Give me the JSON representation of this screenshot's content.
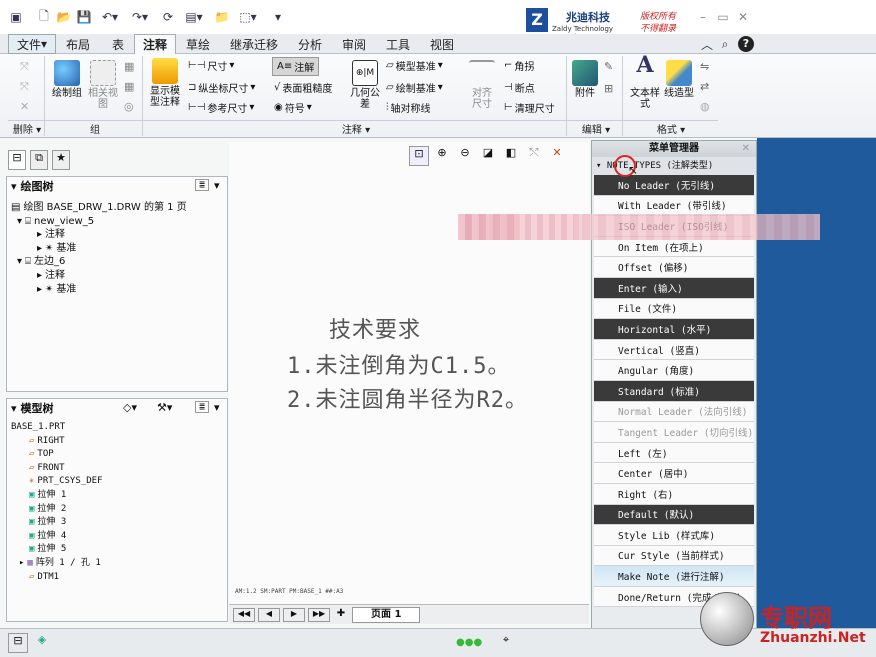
{
  "tabs": [
    "文件",
    "布局",
    "表",
    "注释",
    "草绘",
    "继承迁移",
    "分析",
    "审阅",
    "工具",
    "视图"
  ],
  "logo": {
    "company": "兆迪科技",
    "sub": "Zaldy Technology Co.,Ltd.",
    "note1": "版权所有",
    "note2": "不得翻录"
  },
  "ribbon": {
    "draw_group": "绘制组",
    "related_view": "相关视图",
    "show_model": "显示模型注释",
    "dim": "尺寸",
    "ordinate": "纵坐标尺寸",
    "ref_dim": "参考尺寸",
    "note": "注解",
    "surface": "表面粗糙度",
    "symbol": "符号",
    "geo_tol": "几何公差",
    "model_datum": "模型基准",
    "draw_datum": "绘制基准",
    "axis_sym": "轴对称线",
    "align": "对齐尺寸",
    "corner": "角拐",
    "breakpt": "断点",
    "clean": "清理尺寸",
    "attach": "附件",
    "text_style": "文本样式",
    "line_style": "线造型",
    "g_delete": "删除",
    "g_group": "组",
    "g_annot": "注释",
    "g_edit": "编辑",
    "g_format": "格式"
  },
  "draw_tree": {
    "title": "绘图树",
    "items": [
      "绘图 BASE_DRW_1.DRW 的第 1 页",
      "new_view_5",
      "注释",
      "基准",
      "左边_6",
      "注释",
      "基准"
    ]
  },
  "model_tree": {
    "title": "模型树",
    "items": [
      "BASE_1.PRT",
      "RIGHT",
      "TOP",
      "FRONT",
      "PRT_CSYS_DEF",
      "拉伸 1",
      "拉伸 2",
      "拉伸 3",
      "拉伸 4",
      "拉伸 5",
      "阵列 1 / 孔 1",
      "DTM1"
    ]
  },
  "canvas_note": {
    "l1": "技术要求",
    "l2": "1.未注倒角为C1.5。",
    "l3": "2.未注圆角半径为R2。"
  },
  "canvas_status": "AM:1.2     SM:PART  PM:BASE_1  ##:A3",
  "page_label": "页面 1",
  "menu": {
    "title": "菜单管理器",
    "header": "NOTE TYPES (注解类型)",
    "items": [
      {
        "t": "No Leader (无引线)",
        "s": "hl"
      },
      {
        "t": "With Leader (带引线)",
        "s": ""
      },
      {
        "t": "ISO Leader (ISO引线)",
        "s": ""
      },
      {
        "t": "On Item (在项上)",
        "s": ""
      },
      {
        "t": "Offset (偏移)",
        "s": ""
      },
      {
        "t": "Enter (输入)",
        "s": "hl"
      },
      {
        "t": "File (文件)",
        "s": ""
      },
      {
        "t": "Horizontal (水平)",
        "s": "hl"
      },
      {
        "t": "Vertical (竖直)",
        "s": ""
      },
      {
        "t": "Angular (角度)",
        "s": ""
      },
      {
        "t": "Standard (标准)",
        "s": "hl"
      },
      {
        "t": "Normal Leader (法向引线)",
        "s": "dis"
      },
      {
        "t": "Tangent Leader (切向引线)",
        "s": "dis"
      },
      {
        "t": "Left (左)",
        "s": ""
      },
      {
        "t": "Center (居中)",
        "s": ""
      },
      {
        "t": "Right (右)",
        "s": ""
      },
      {
        "t": "Default (默认)",
        "s": "hl"
      },
      {
        "t": "Style Lib (样式库)",
        "s": ""
      },
      {
        "t": "Cur Style (当前样式)",
        "s": ""
      },
      {
        "t": "Make Note (进行注解)",
        "s": "active"
      },
      {
        "t": "Done/Return (完成/返回)",
        "s": ""
      }
    ]
  },
  "watermark": {
    "cn": "专职网",
    "en": "Zhuanzhi.Net"
  }
}
